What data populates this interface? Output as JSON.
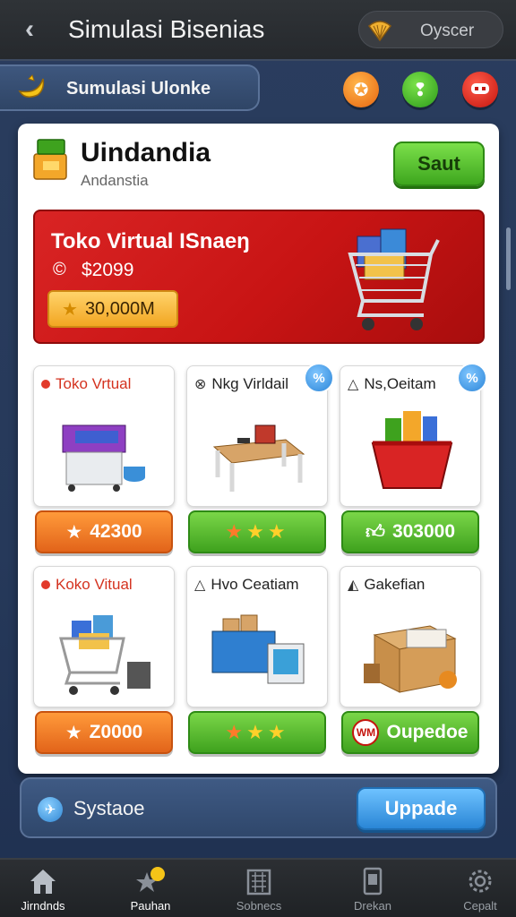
{
  "header": {
    "title": "Simulasi Bisenias",
    "user_name": "Oyscer"
  },
  "section": {
    "label": "Sumulasi Ulonke"
  },
  "store": {
    "name": "Uindandia",
    "subtitle": "Andanstia",
    "save_label": "Saut"
  },
  "banner": {
    "title": "Toko Virtual ISnaeŋ",
    "price": "$2099",
    "coins": "30,000M"
  },
  "cards": [
    {
      "title": "Toko Vrtual",
      "price": "42300",
      "price_style": "orange",
      "badge": ""
    },
    {
      "title": "Nkg Virldail",
      "price": "",
      "price_style": "green-stars",
      "badge": "%"
    },
    {
      "title": "Ns,Oeitam",
      "price": "303000",
      "price_style": "green",
      "badge": "%"
    },
    {
      "title": "Koko Vitual",
      "price": "Z0000",
      "price_style": "orange",
      "badge": ""
    },
    {
      "title": "Hvo Ceatiam",
      "price": "",
      "price_style": "green-stars",
      "badge": ""
    },
    {
      "title": "Gakefian",
      "price": "Oupedoe",
      "price_style": "green",
      "badge": ""
    }
  ],
  "bottom_strip": {
    "label": "Systaoe",
    "upgrade_label": "Uppade"
  },
  "nav": [
    {
      "label": "Jirndnds",
      "icon": "home-icon"
    },
    {
      "label": "Pauhan",
      "icon": "star-chat-icon"
    },
    {
      "label": "Sobnecs",
      "icon": "building-icon"
    },
    {
      "label": "Drekan",
      "icon": "phone-icon"
    },
    {
      "label": "Cepalt",
      "icon": "settings-gear-icon"
    }
  ],
  "colors": {
    "accent_green": "#3ea61e",
    "accent_orange": "#e2641a",
    "banner_red": "#c81414",
    "accent_blue": "#2a86d6"
  }
}
